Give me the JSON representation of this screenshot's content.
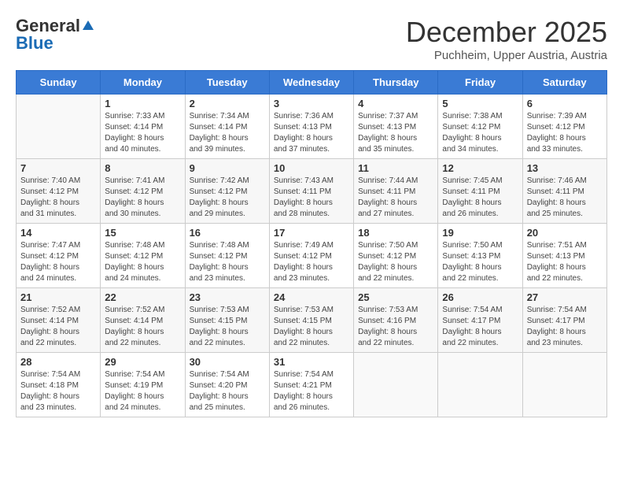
{
  "logo": {
    "general": "General",
    "blue": "Blue"
  },
  "header": {
    "month": "December 2025",
    "location": "Puchheim, Upper Austria, Austria"
  },
  "weekdays": [
    "Sunday",
    "Monday",
    "Tuesday",
    "Wednesday",
    "Thursday",
    "Friday",
    "Saturday"
  ],
  "weeks": [
    [
      {
        "day": "",
        "info": ""
      },
      {
        "day": "1",
        "info": "Sunrise: 7:33 AM\nSunset: 4:14 PM\nDaylight: 8 hours\nand 40 minutes."
      },
      {
        "day": "2",
        "info": "Sunrise: 7:34 AM\nSunset: 4:14 PM\nDaylight: 8 hours\nand 39 minutes."
      },
      {
        "day": "3",
        "info": "Sunrise: 7:36 AM\nSunset: 4:13 PM\nDaylight: 8 hours\nand 37 minutes."
      },
      {
        "day": "4",
        "info": "Sunrise: 7:37 AM\nSunset: 4:13 PM\nDaylight: 8 hours\nand 35 minutes."
      },
      {
        "day": "5",
        "info": "Sunrise: 7:38 AM\nSunset: 4:12 PM\nDaylight: 8 hours\nand 34 minutes."
      },
      {
        "day": "6",
        "info": "Sunrise: 7:39 AM\nSunset: 4:12 PM\nDaylight: 8 hours\nand 33 minutes."
      }
    ],
    [
      {
        "day": "7",
        "info": "Sunrise: 7:40 AM\nSunset: 4:12 PM\nDaylight: 8 hours\nand 31 minutes."
      },
      {
        "day": "8",
        "info": "Sunrise: 7:41 AM\nSunset: 4:12 PM\nDaylight: 8 hours\nand 30 minutes."
      },
      {
        "day": "9",
        "info": "Sunrise: 7:42 AM\nSunset: 4:12 PM\nDaylight: 8 hours\nand 29 minutes."
      },
      {
        "day": "10",
        "info": "Sunrise: 7:43 AM\nSunset: 4:11 PM\nDaylight: 8 hours\nand 28 minutes."
      },
      {
        "day": "11",
        "info": "Sunrise: 7:44 AM\nSunset: 4:11 PM\nDaylight: 8 hours\nand 27 minutes."
      },
      {
        "day": "12",
        "info": "Sunrise: 7:45 AM\nSunset: 4:11 PM\nDaylight: 8 hours\nand 26 minutes."
      },
      {
        "day": "13",
        "info": "Sunrise: 7:46 AM\nSunset: 4:11 PM\nDaylight: 8 hours\nand 25 minutes."
      }
    ],
    [
      {
        "day": "14",
        "info": "Sunrise: 7:47 AM\nSunset: 4:12 PM\nDaylight: 8 hours\nand 24 minutes."
      },
      {
        "day": "15",
        "info": "Sunrise: 7:48 AM\nSunset: 4:12 PM\nDaylight: 8 hours\nand 24 minutes."
      },
      {
        "day": "16",
        "info": "Sunrise: 7:48 AM\nSunset: 4:12 PM\nDaylight: 8 hours\nand 23 minutes."
      },
      {
        "day": "17",
        "info": "Sunrise: 7:49 AM\nSunset: 4:12 PM\nDaylight: 8 hours\nand 23 minutes."
      },
      {
        "day": "18",
        "info": "Sunrise: 7:50 AM\nSunset: 4:12 PM\nDaylight: 8 hours\nand 22 minutes."
      },
      {
        "day": "19",
        "info": "Sunrise: 7:50 AM\nSunset: 4:13 PM\nDaylight: 8 hours\nand 22 minutes."
      },
      {
        "day": "20",
        "info": "Sunrise: 7:51 AM\nSunset: 4:13 PM\nDaylight: 8 hours\nand 22 minutes."
      }
    ],
    [
      {
        "day": "21",
        "info": "Sunrise: 7:52 AM\nSunset: 4:14 PM\nDaylight: 8 hours\nand 22 minutes."
      },
      {
        "day": "22",
        "info": "Sunrise: 7:52 AM\nSunset: 4:14 PM\nDaylight: 8 hours\nand 22 minutes."
      },
      {
        "day": "23",
        "info": "Sunrise: 7:53 AM\nSunset: 4:15 PM\nDaylight: 8 hours\nand 22 minutes."
      },
      {
        "day": "24",
        "info": "Sunrise: 7:53 AM\nSunset: 4:15 PM\nDaylight: 8 hours\nand 22 minutes."
      },
      {
        "day": "25",
        "info": "Sunrise: 7:53 AM\nSunset: 4:16 PM\nDaylight: 8 hours\nand 22 minutes."
      },
      {
        "day": "26",
        "info": "Sunrise: 7:54 AM\nSunset: 4:17 PM\nDaylight: 8 hours\nand 22 minutes."
      },
      {
        "day": "27",
        "info": "Sunrise: 7:54 AM\nSunset: 4:17 PM\nDaylight: 8 hours\nand 23 minutes."
      }
    ],
    [
      {
        "day": "28",
        "info": "Sunrise: 7:54 AM\nSunset: 4:18 PM\nDaylight: 8 hours\nand 23 minutes."
      },
      {
        "day": "29",
        "info": "Sunrise: 7:54 AM\nSunset: 4:19 PM\nDaylight: 8 hours\nand 24 minutes."
      },
      {
        "day": "30",
        "info": "Sunrise: 7:54 AM\nSunset: 4:20 PM\nDaylight: 8 hours\nand 25 minutes."
      },
      {
        "day": "31",
        "info": "Sunrise: 7:54 AM\nSunset: 4:21 PM\nDaylight: 8 hours\nand 26 minutes."
      },
      {
        "day": "",
        "info": ""
      },
      {
        "day": "",
        "info": ""
      },
      {
        "day": "",
        "info": ""
      }
    ]
  ]
}
